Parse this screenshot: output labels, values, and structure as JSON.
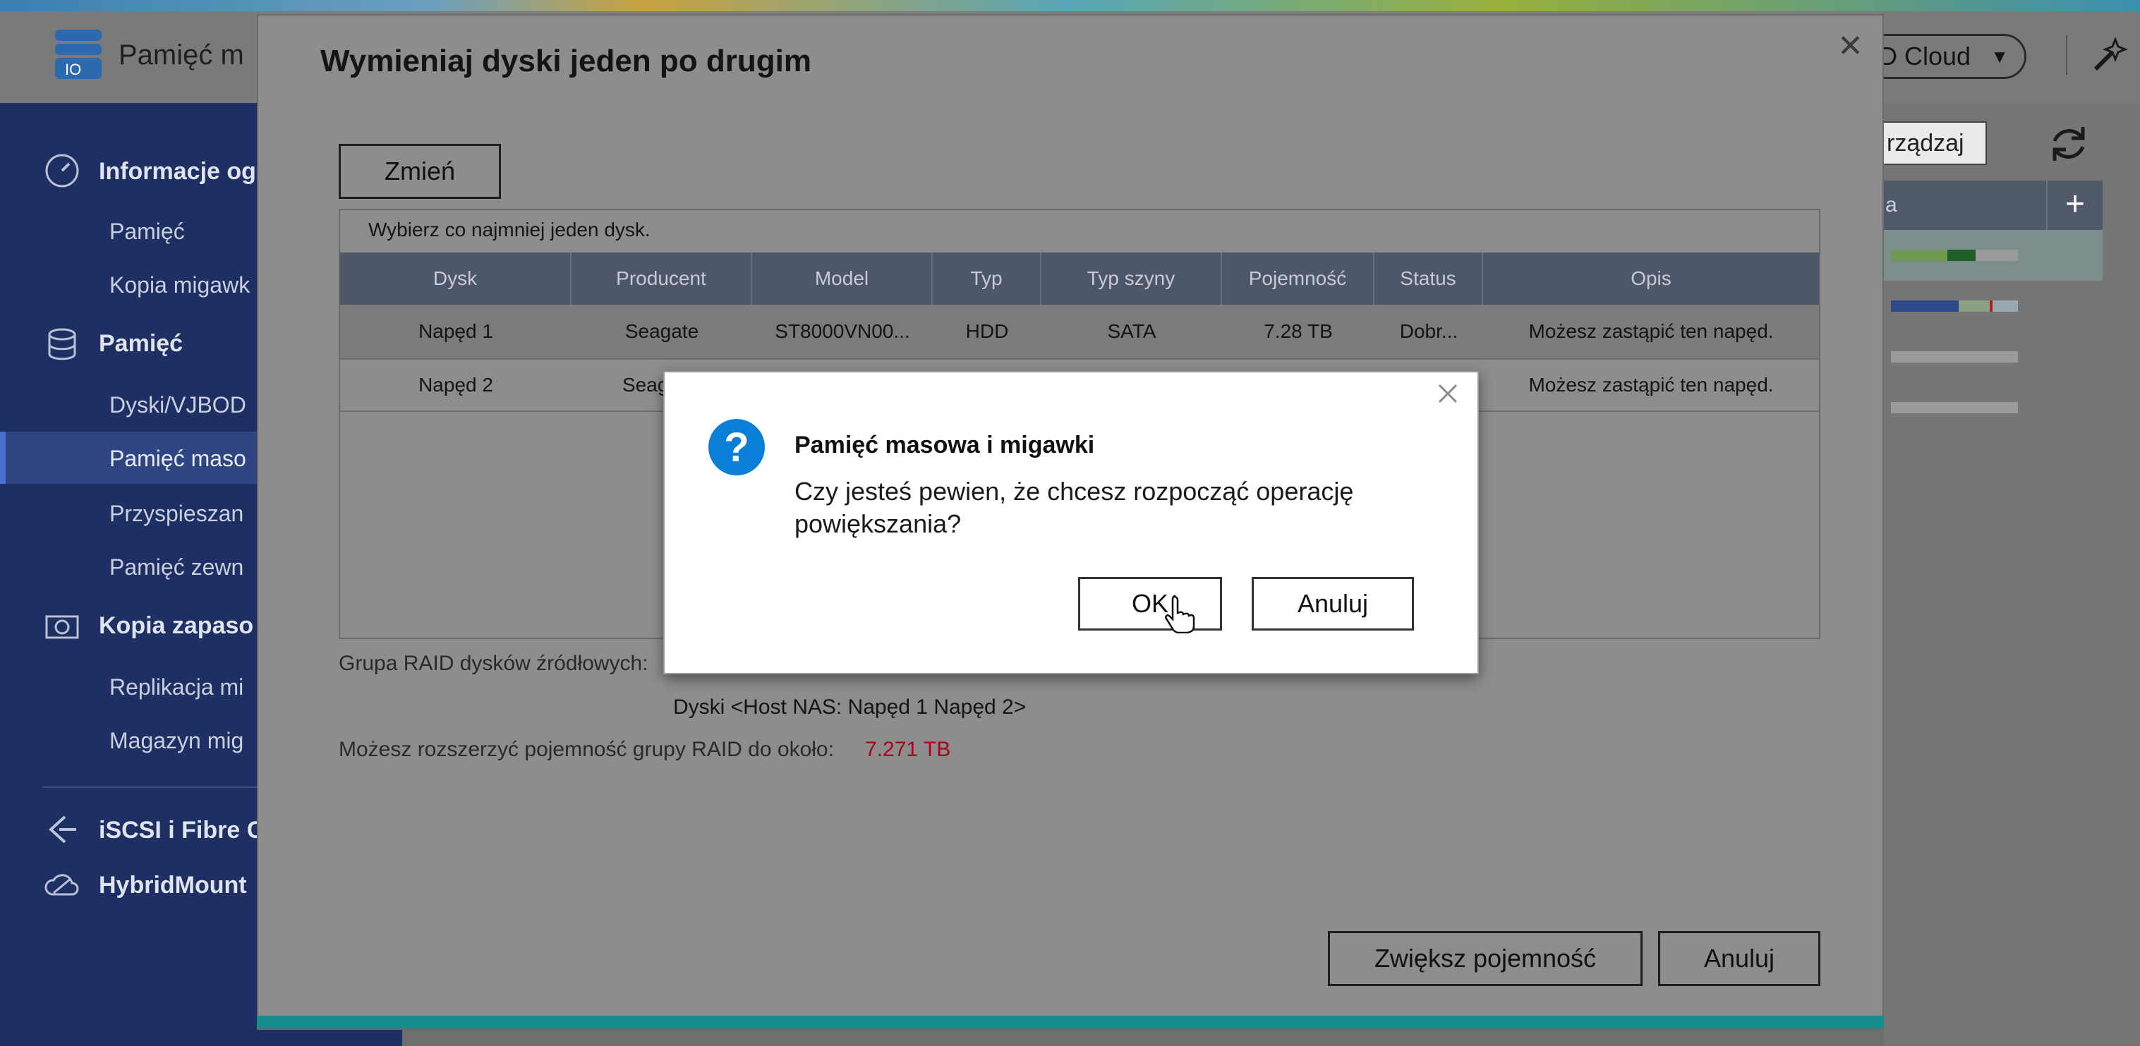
{
  "app": {
    "title": "Pamięć m",
    "cloud_button": "D Cloud",
    "manage_button": "rządzaj",
    "right_table_header": "a"
  },
  "sidebar": {
    "sections": [
      {
        "label": "Informacje og",
        "icon": "gauge-icon"
      },
      {
        "label": "Pamięć",
        "icon": "database-icon"
      },
      {
        "label": "Kopia zapaso",
        "icon": "camera-icon"
      }
    ],
    "items": [
      {
        "label": "Pamięć"
      },
      {
        "label": "Kopia migawk"
      },
      {
        "label": "Dyski/VJBOD"
      },
      {
        "label": "Pamięć maso"
      },
      {
        "label": "Przyspieszan"
      },
      {
        "label": "Pamięć zewn"
      },
      {
        "label": "Replikacja mi"
      },
      {
        "label": "Magazyn mig"
      }
    ],
    "bottom": [
      {
        "label": "iSCSI i Fibre C",
        "icon": "iscsi-icon"
      },
      {
        "label": "HybridMount",
        "icon": "cloud-mount-icon"
      }
    ]
  },
  "modal": {
    "title": "Wymieniaj dyski jeden po drugim",
    "change_button": "Zmień",
    "hint": "Wybierz co najmniej jeden dysk.",
    "columns": [
      "Dysk",
      "Producent",
      "Model",
      "Typ",
      "Typ szyny",
      "Pojemność",
      "Status",
      "Opis"
    ],
    "rows": [
      [
        "Napęd 1",
        "Seagate",
        "ST8000VN00...",
        "HDD",
        "SATA",
        "7.28 TB",
        "Dobr...",
        "Możesz zastąpić ten napęd."
      ],
      [
        "Napęd 2",
        "Seag",
        "",
        "",
        "",
        "",
        "",
        "Możesz zastąpić ten napęd."
      ]
    ],
    "raid_label": "Grupa RAID dysków źródłowych:",
    "raid_disks": "Dyski <Host NAS: Napęd 1 Napęd 2>",
    "expand_label": "Możesz rozszerzyć pojemność grupy RAID do około:",
    "expand_value": "7.271 TB",
    "increase_button": "Zwiększ pojemność",
    "cancel_button": "Anuluj"
  },
  "dialog": {
    "title": "Pamięć masowa i migawki",
    "message": "Czy jesteś pewien, że chcesz rozpocząć operację powiększania?",
    "ok_button": "OK",
    "cancel_button": "Anuluj"
  },
  "colors": {
    "sidebar_bg": "#1e2f63",
    "accent_teal": "#178c8c",
    "table_header": "#4e566a",
    "value_red": "#b0001a",
    "question_blue": "#0a7fd8"
  }
}
